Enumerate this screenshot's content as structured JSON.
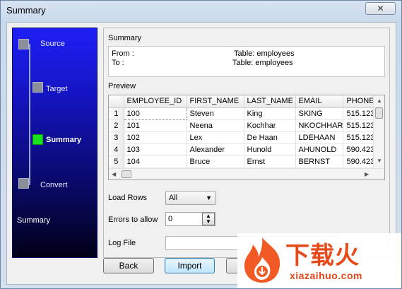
{
  "window": {
    "title": "Summary",
    "close_glyph": "✕"
  },
  "nav": {
    "steps": [
      {
        "label": "Source",
        "active": false
      },
      {
        "label": "Target",
        "active": false
      },
      {
        "label": "Summary",
        "active": true
      },
      {
        "label": "Convert",
        "active": false
      }
    ],
    "current_label": "Summary"
  },
  "summary": {
    "heading": "Summary",
    "from_label": "From :",
    "from_table": "Table: employees",
    "to_label": "To :",
    "to_table": "Table: employees"
  },
  "preview": {
    "label": "Preview",
    "columns": [
      "EMPLOYEE_ID",
      "FIRST_NAME",
      "LAST_NAME",
      "EMAIL",
      "PHONE_"
    ],
    "rows": [
      {
        "n": "1",
        "cells": [
          "100",
          "Steven",
          "King",
          "SKING",
          "515.123"
        ]
      },
      {
        "n": "2",
        "cells": [
          "101",
          "Neena",
          "Kochhar",
          "NKOCHHAR",
          "515.123"
        ]
      },
      {
        "n": "3",
        "cells": [
          "102",
          "Lex",
          "De Haan",
          "LDEHAAN",
          "515.123"
        ]
      },
      {
        "n": "4",
        "cells": [
          "103",
          "Alexander",
          "Hunold",
          "AHUNOLD",
          "590.423"
        ]
      },
      {
        "n": "5",
        "cells": [
          "104",
          "Bruce",
          "Ernst",
          "BERNST",
          "590.423"
        ]
      }
    ]
  },
  "options": {
    "load_rows_label": "Load Rows",
    "load_rows_value": "All",
    "errors_label": "Errors to allow",
    "errors_value": "0",
    "log_file_label": "Log File",
    "log_file_value": ""
  },
  "buttons": {
    "back": "Back",
    "import": "Import"
  },
  "watermark": {
    "cn_text": "下载火",
    "url": "xiazaihuo.com"
  },
  "colors": {
    "nav_active": "#19e31e",
    "watermark": "#e64a19"
  }
}
